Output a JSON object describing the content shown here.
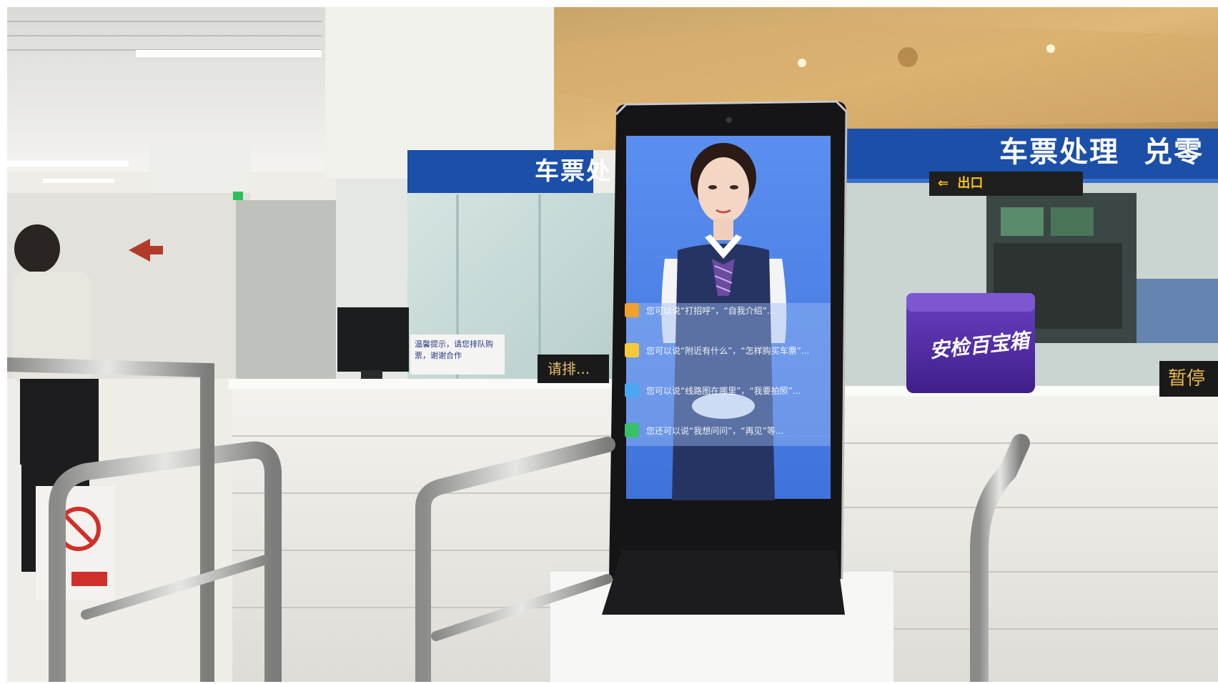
{
  "scene": {
    "overhead_sign_left": "车票处",
    "overhead_sign_right": "车票处理",
    "overhead_sign_right_cut": "兑零",
    "exit_sign": {
      "arrow": "⇐",
      "label": "出口"
    },
    "pause_sign": "暂停",
    "window_sign": "请排...",
    "notice_card": "温馨提示，请您排队购票，谢谢合作",
    "case_label": "安检百宝箱"
  },
  "kiosk": {
    "menu_items": [
      {
        "icon": "user-icon",
        "color": "#f0a02c",
        "text": "您可以说“打招呼”，“自我介绍”..."
      },
      {
        "icon": "ticket-icon",
        "color": "#f5c93a",
        "text": "您可以说“附近有什么”，“怎样购买车票”..."
      },
      {
        "icon": "photo-icon",
        "color": "#4aa8f0",
        "text": "您可以说“线路图在哪里”，“我要拍照”..."
      },
      {
        "icon": "chat-icon",
        "color": "#35c267",
        "text": "您还可以说“我想问问”，“再见”等..."
      }
    ]
  },
  "colors": {
    "screen_blue": "#4a7fe0",
    "sign_blue": "#1b4fa8",
    "uniform_navy": "#263463"
  }
}
